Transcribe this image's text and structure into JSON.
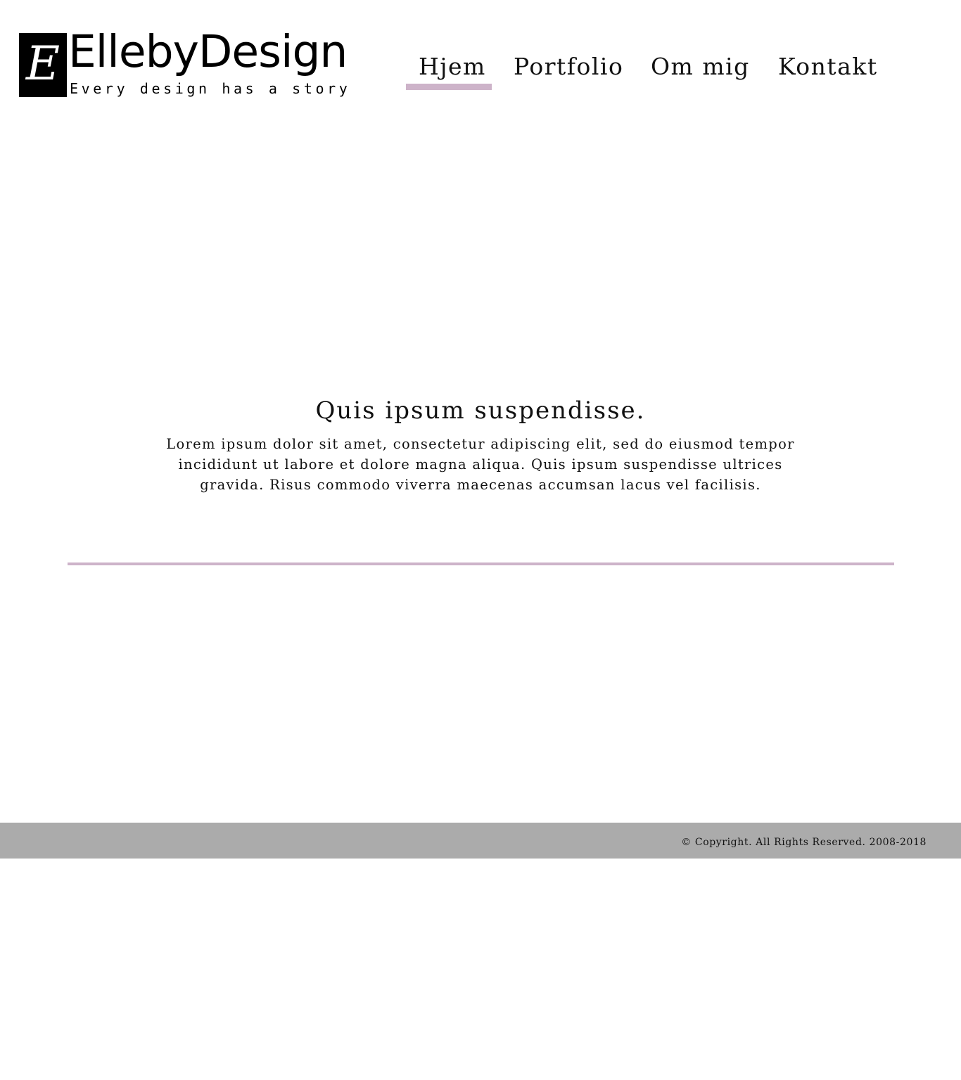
{
  "header": {
    "logo_letter": "E",
    "site_name": "EllebyDesign",
    "tagline": "Every design has a story"
  },
  "nav": {
    "items": [
      {
        "label": "Hjem",
        "active": true
      },
      {
        "label": "Portfolio",
        "active": false
      },
      {
        "label": "Om mig",
        "active": false
      },
      {
        "label": "Kontakt",
        "active": false
      }
    ]
  },
  "hero": {
    "title": "Quis ipsum suspendisse.",
    "body": "Lorem ipsum dolor sit amet, consectetur adipiscing elit, sed do eiusmod tempor incididunt ut labore et dolore magna aliqua. Quis ipsum suspendisse ultrices gravida. Risus commodo viverra maecenas accumsan lacus vel facilisis."
  },
  "footer": {
    "copyright": "© Copyright. All Rights Reserved. 2008-2018"
  },
  "colors": {
    "accent": "#cdb3c9",
    "footer_bg": "#ababab",
    "logo_bg": "#000000"
  }
}
